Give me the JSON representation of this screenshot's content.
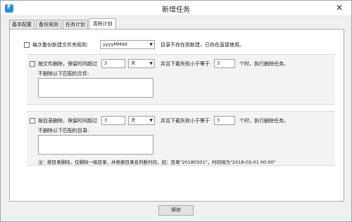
{
  "window": {
    "title": "新增任务",
    "close_glyph": "✕"
  },
  "tabs": [
    {
      "label": "基本配置"
    },
    {
      "label": "备份规则"
    },
    {
      "label": "任务计划"
    },
    {
      "label": "清除计划",
      "active": true
    }
  ],
  "folder_rule": {
    "label": "每次备份新建文件夹规则:",
    "value": "yyyyMMdd",
    "hint": "目录不存在则新建，已存在直接使用。"
  },
  "file_delete": {
    "label": "按文件删除，保留时间超过",
    "days": "3",
    "unit": "天",
    "count_label": "并且下载失败小于等于",
    "count": "3",
    "suffix": "个时，执行删除任务。",
    "exclude_label": "不删除以下匹配的文件:"
  },
  "dir_delete": {
    "label": "按目录删除，保留时间超过",
    "days": "3",
    "unit": "天",
    "count_label": "并且下载失败小于等于",
    "count": "3",
    "suffix": "个时，执行删除任务。",
    "exclude_label": "不删除以下匹配的目录:",
    "note": "注：按目录删除，仅删除一级目录，并根据目录名判断时间，如：目录\"20180301\"，时间视为\"2018-03-01 00:00\""
  },
  "footer": {
    "save_label": "保存"
  },
  "colors": {
    "accent": "#1d8fe0",
    "window_bg": "#f0f0f0"
  },
  "icons": {
    "app": "app-logo-icon",
    "close": "close-icon",
    "dropdown": "chevron-down-icon"
  }
}
